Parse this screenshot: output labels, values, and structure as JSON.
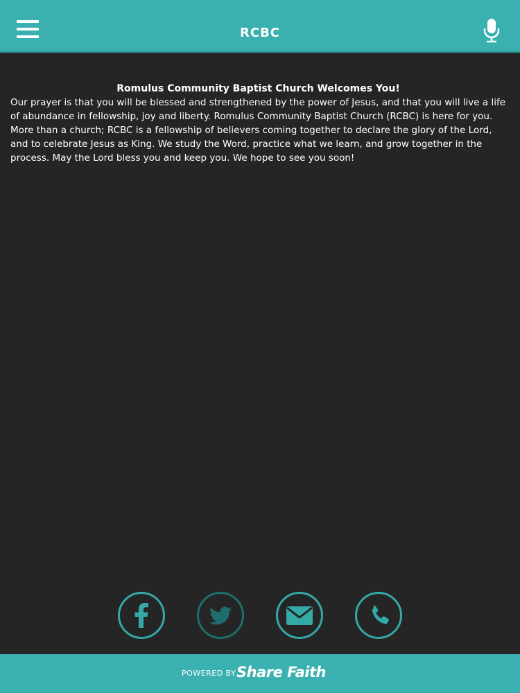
{
  "header": {
    "title": "RCBC",
    "menu_icon": "hamburger-menu-icon",
    "mic_icon": "microphone-icon"
  },
  "content": {
    "title": "Romulus Community Baptist Church Welcomes You!",
    "body": "Our prayer is that you will be blessed and strengthened by the power of Jesus, and that you will live a life of abundance in fellowship, joy and liberty. Romulus Community Baptist Church (RCBC) is here for you. More than a church; RCBC is a fellowship of believers coming together to declare the glory of the Lord, and to celebrate Jesus as King. We study the Word, practice what we learn, and grow together in the process. May the Lord bless you and keep you. We hope to see you soon!"
  },
  "social": [
    {
      "icon": "facebook-icon"
    },
    {
      "icon": "twitter-icon"
    },
    {
      "icon": "email-icon"
    },
    {
      "icon": "phone-icon"
    }
  ],
  "footer": {
    "powered_by": "POWERED BY",
    "brand": "Share Faith"
  },
  "colors": {
    "accent": "#3bb0b0",
    "background": "#252525",
    "text": "#ffffff",
    "icon_ring": "#35a8a8"
  }
}
